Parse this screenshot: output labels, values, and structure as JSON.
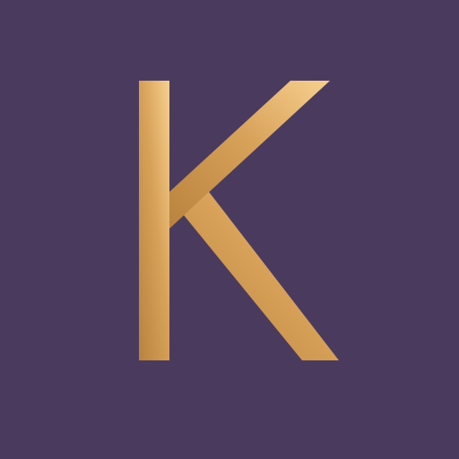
{
  "icon": {
    "letter": "K",
    "background_color": "#4a3b5e",
    "gradient": {
      "light": "#f7d08f",
      "mid": "#d8a25a",
      "dark": "#b9823e"
    }
  }
}
